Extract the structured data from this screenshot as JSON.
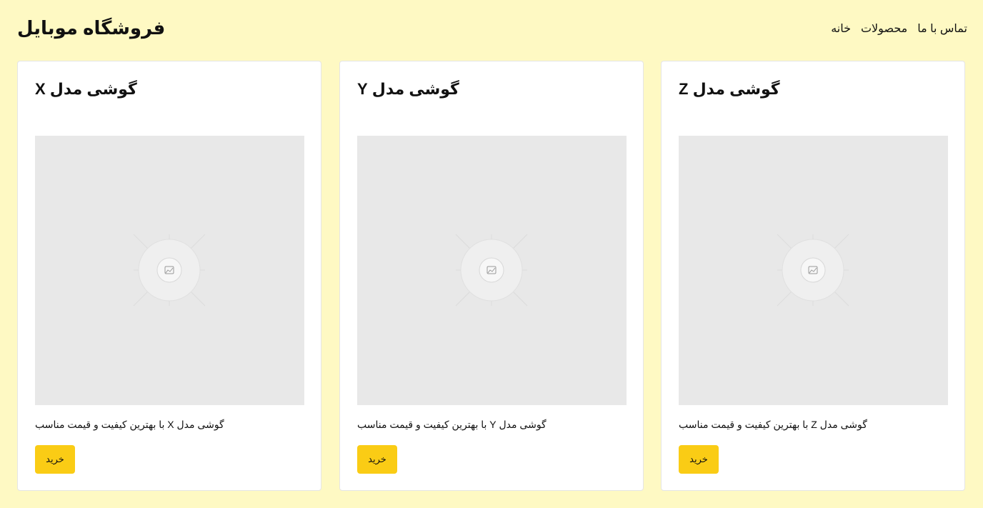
{
  "header": {
    "site_title": "فروشگاه موبایل",
    "nav": [
      {
        "label": "خانه"
      },
      {
        "label": "محصولات"
      },
      {
        "label": "تماس با ما"
      }
    ]
  },
  "products": [
    {
      "title": "گوشی مدل X",
      "image_icon": "image-placeholder-icon",
      "description": "گوشی مدل X با بهترین کیفیت و قیمت مناسب",
      "buy_label": "خرید"
    },
    {
      "title": "گوشی مدل Y",
      "image_icon": "image-placeholder-icon",
      "description": "گوشی مدل Y با بهترین کیفیت و قیمت مناسب",
      "buy_label": "خرید"
    },
    {
      "title": "گوشی مدل Z",
      "image_icon": "image-placeholder-icon",
      "description": "گوشی مدل Z با بهترین کیفیت و قیمت مناسب",
      "buy_label": "خرید"
    }
  ],
  "colors": {
    "page_background": "#fef9c3",
    "button": "#facc15",
    "card_background": "#ffffff",
    "image_placeholder": "#e8e8e8"
  }
}
